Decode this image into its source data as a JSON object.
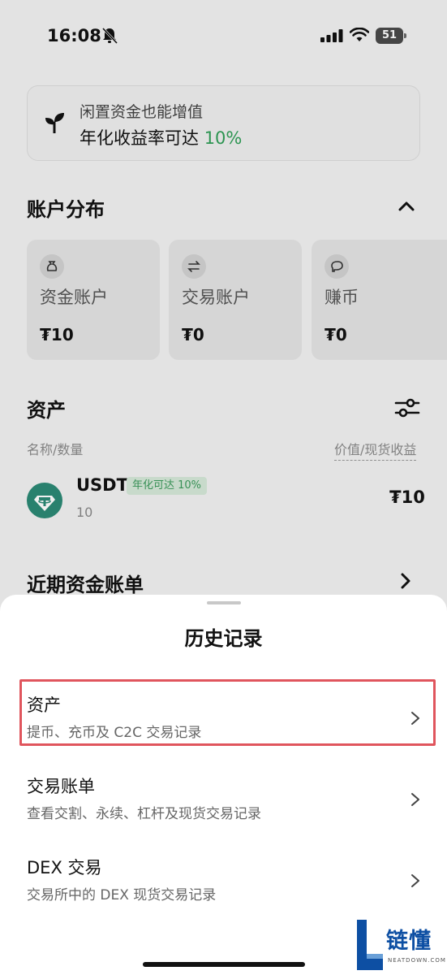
{
  "status_bar": {
    "time": "16:08",
    "battery": "51"
  },
  "promo": {
    "line1": "闲置资金也能增值",
    "line2_prefix": "年化收益率可达 ",
    "rate": "10%"
  },
  "account_distribution": {
    "title": "账户分布",
    "accounts": [
      {
        "icon": "money-bag-icon",
        "label": "资金账户",
        "value": "₮10"
      },
      {
        "icon": "swap-icon",
        "label": "交易账户",
        "value": "₮0"
      },
      {
        "icon": "piggy-icon",
        "label": "赚币",
        "value": "₮0"
      }
    ]
  },
  "assets": {
    "title": "资产",
    "col_left": "名称/数量",
    "col_right": "价值/现货收益",
    "rows": [
      {
        "name": "USDT",
        "badge": "年化可达 10%",
        "qty": "10",
        "value": "₮10"
      }
    ]
  },
  "recent_bills": {
    "title": "近期资金账单"
  },
  "sheet": {
    "title": "历史记录",
    "items": [
      {
        "title": "资产",
        "subtitle": "提币、充币及 C2C 交易记录",
        "highlighted": true
      },
      {
        "title": "交易账单",
        "subtitle": "查看交割、永续、杠杆及现货交易记录"
      },
      {
        "title": "DEX 交易",
        "subtitle": "交易所中的 DEX 现货交易记录"
      }
    ]
  },
  "watermark": {
    "text": "链懂",
    "sub": "NEATDOWN.COM"
  },
  "colors": {
    "accent_green": "#2f9e57",
    "highlight_red": "#e0555d",
    "tether_green": "#2c8a75"
  }
}
